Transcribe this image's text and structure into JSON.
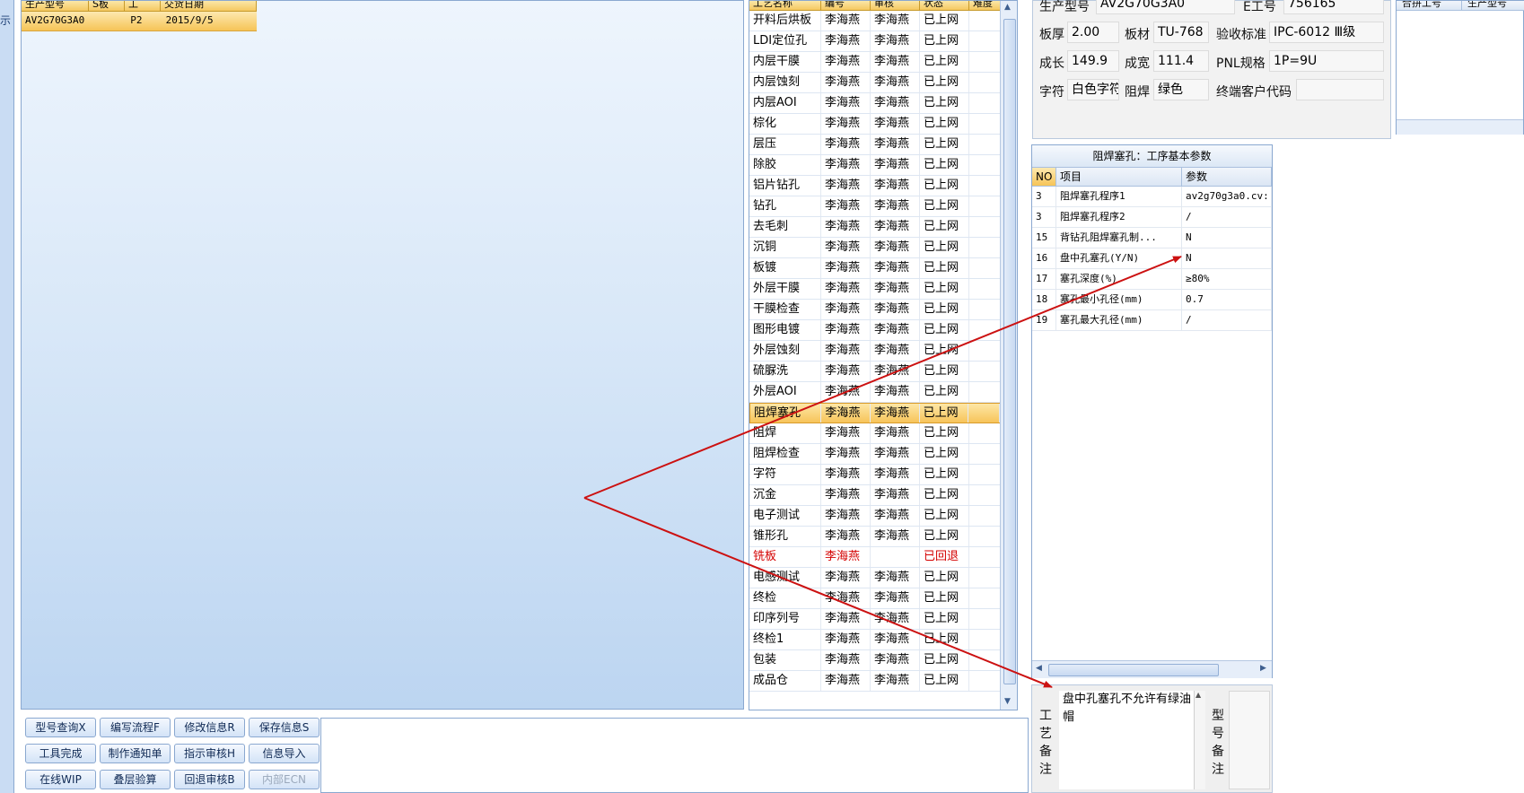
{
  "left_strip": {
    "label": "示"
  },
  "product_grid": {
    "columns": [
      "生产型号",
      "S板",
      "工",
      "交货日期"
    ],
    "row": {
      "model": "AV2G70G3A0",
      "s_board": "",
      "stage": "P2",
      "delivery_date": "2015/9/5"
    }
  },
  "process_grid": {
    "columns": [
      "工艺名称",
      "编号",
      "审核",
      "状态",
      "难度"
    ],
    "rows": [
      {
        "name": "开料后烘板",
        "editor": "李海燕",
        "reviewer": "李海燕",
        "status": "已上网"
      },
      {
        "name": "LDI定位孔",
        "editor": "李海燕",
        "reviewer": "李海燕",
        "status": "已上网"
      },
      {
        "name": "内层干膜",
        "editor": "李海燕",
        "reviewer": "李海燕",
        "status": "已上网"
      },
      {
        "name": "内层蚀刻",
        "editor": "李海燕",
        "reviewer": "李海燕",
        "status": "已上网"
      },
      {
        "name": "内层AOI",
        "editor": "李海燕",
        "reviewer": "李海燕",
        "status": "已上网"
      },
      {
        "name": "棕化",
        "editor": "李海燕",
        "reviewer": "李海燕",
        "status": "已上网"
      },
      {
        "name": "层压",
        "editor": "李海燕",
        "reviewer": "李海燕",
        "status": "已上网"
      },
      {
        "name": "除胶",
        "editor": "李海燕",
        "reviewer": "李海燕",
        "status": "已上网"
      },
      {
        "name": "铝片钻孔",
        "editor": "李海燕",
        "reviewer": "李海燕",
        "status": "已上网"
      },
      {
        "name": "钻孔",
        "editor": "李海燕",
        "reviewer": "李海燕",
        "status": "已上网"
      },
      {
        "name": "去毛刺",
        "editor": "李海燕",
        "reviewer": "李海燕",
        "status": "已上网"
      },
      {
        "name": "沉铜",
        "editor": "李海燕",
        "reviewer": "李海燕",
        "status": "已上网"
      },
      {
        "name": "板镀",
        "editor": "李海燕",
        "reviewer": "李海燕",
        "status": "已上网"
      },
      {
        "name": "外层干膜",
        "editor": "李海燕",
        "reviewer": "李海燕",
        "status": "已上网"
      },
      {
        "name": "干膜检查",
        "editor": "李海燕",
        "reviewer": "李海燕",
        "status": "已上网"
      },
      {
        "name": "图形电镀",
        "editor": "李海燕",
        "reviewer": "李海燕",
        "status": "已上网"
      },
      {
        "name": "外层蚀刻",
        "editor": "李海燕",
        "reviewer": "李海燕",
        "status": "已上网"
      },
      {
        "name": "硫脲洗",
        "editor": "李海燕",
        "reviewer": "李海燕",
        "status": "已上网"
      },
      {
        "name": "外层AOI",
        "editor": "李海燕",
        "reviewer": "李海燕",
        "status": "已上网"
      },
      {
        "name": "阻焊塞孔",
        "editor": "李海燕",
        "reviewer": "李海燕",
        "status": "已上网",
        "selected": true
      },
      {
        "name": "阻焊",
        "editor": "李海燕",
        "reviewer": "李海燕",
        "status": "已上网"
      },
      {
        "name": "阻焊检查",
        "editor": "李海燕",
        "reviewer": "李海燕",
        "status": "已上网"
      },
      {
        "name": "字符",
        "editor": "李海燕",
        "reviewer": "李海燕",
        "status": "已上网"
      },
      {
        "name": "沉金",
        "editor": "李海燕",
        "reviewer": "李海燕",
        "status": "已上网"
      },
      {
        "name": "电子测试",
        "editor": "李海燕",
        "reviewer": "李海燕",
        "status": "已上网"
      },
      {
        "name": "锥形孔",
        "editor": "李海燕",
        "reviewer": "李海燕",
        "status": "已上网"
      },
      {
        "name": "铣板",
        "editor": "李海燕",
        "reviewer": "",
        "status": "已回退",
        "returned": true
      },
      {
        "name": "电感测试",
        "editor": "李海燕",
        "reviewer": "李海燕",
        "status": "已上网"
      },
      {
        "name": "终检",
        "editor": "李海燕",
        "reviewer": "李海燕",
        "status": "已上网"
      },
      {
        "name": "印序列号",
        "editor": "李海燕",
        "reviewer": "李海燕",
        "status": "已上网"
      },
      {
        "name": "终检1",
        "editor": "李海燕",
        "reviewer": "李海燕",
        "status": "已上网"
      },
      {
        "name": "包装",
        "editor": "李海燕",
        "reviewer": "李海燕",
        "status": "已上网"
      },
      {
        "name": "成品仓",
        "editor": "李海燕",
        "reviewer": "李海燕",
        "status": "已上网"
      }
    ]
  },
  "toolbar": {
    "buttons": [
      {
        "label": "型号查询X",
        "enabled": true
      },
      {
        "label": "编写流程F",
        "enabled": true
      },
      {
        "label": "修改信息R",
        "enabled": true
      },
      {
        "label": "保存信息S",
        "enabled": true
      },
      {
        "label": "工具完成",
        "enabled": true
      },
      {
        "label": "制作通知单",
        "enabled": true
      },
      {
        "label": "指示审核H",
        "enabled": true
      },
      {
        "label": "信息导入",
        "enabled": true
      },
      {
        "label": "在线WIP",
        "enabled": true
      },
      {
        "label": "叠层验算",
        "enabled": true
      },
      {
        "label": "回退审核B",
        "enabled": true
      },
      {
        "label": "内部ECN",
        "enabled": false
      }
    ]
  },
  "info": {
    "model_label": "生产型号",
    "model_value": "AV2G70G3A0",
    "eno_label": "E工号",
    "eno_value": "756165",
    "thickness_label": "板厚",
    "thickness_value": "2.00",
    "material_label": "板材",
    "material_value": "TU-768",
    "standard_label": "验收标准",
    "standard_value": "IPC-6012 Ⅲ级",
    "length_label": "成长",
    "length_value": "149.9",
    "width_label": "成宽",
    "width_value": "111.4",
    "pnl_label": "PNL规格",
    "pnl_value": "1P=9U",
    "char_label": "字符",
    "char_value": "白色字符",
    "mask_label": "阻焊",
    "mask_value": "绿色",
    "customer_label": "终端客户代码",
    "customer_value": ""
  },
  "side_grid": {
    "columns": [
      "合拼工号",
      "生产型号"
    ]
  },
  "param_panel": {
    "title": "阻焊塞孔：工序基本参数",
    "columns": [
      "NO",
      "项目",
      "参数"
    ],
    "rows": [
      {
        "no": "3",
        "item": "阻焊塞孔程序1",
        "value": "av2g70g3a0.cv:"
      },
      {
        "no": "3",
        "item": "阻焊塞孔程序2",
        "value": "/"
      },
      {
        "no": "15",
        "item": "背钻孔阻焊塞孔制...",
        "value": "N"
      },
      {
        "no": "16",
        "item": "盘中孔塞孔(Y/N)",
        "value": "N"
      },
      {
        "no": "17",
        "item": "塞孔深度(%)",
        "value": "≥80%"
      },
      {
        "no": "18",
        "item": "塞孔最小孔径(mm)",
        "value": "0.7"
      },
      {
        "no": "19",
        "item": "塞孔最大孔径(mm)",
        "value": "/"
      }
    ]
  },
  "remarks": {
    "process_remark_label": "工艺备注",
    "process_remark_text": "盘中孔塞孔不允许有绿油帽",
    "model_remark_label": "型号备注",
    "model_remark_text": ""
  },
  "colors": {
    "arrow": "#cc1111",
    "selection": "#f7c45a",
    "returned_text": "#d40000"
  }
}
